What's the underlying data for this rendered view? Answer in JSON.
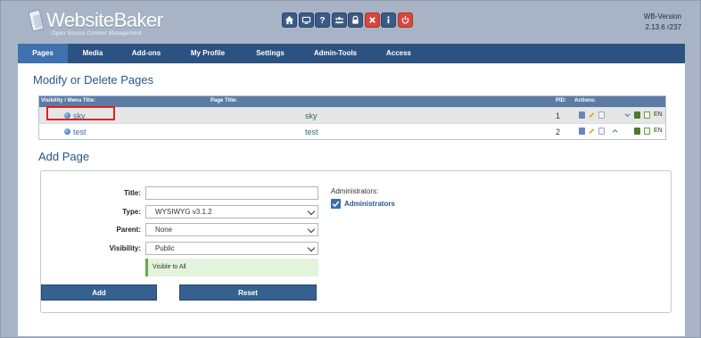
{
  "brand": {
    "name": "WebsiteBaker",
    "tagline": "Open Source Content Management"
  },
  "version": {
    "line1": "WB-Version",
    "line2": "2.13.6 r237"
  },
  "toolbar_icons": [
    "home-icon",
    "monitor-icon",
    "help-icon",
    "users-icon",
    "lock-icon",
    "close-icon",
    "info-icon",
    "power-icon"
  ],
  "nav": [
    {
      "label": "Pages",
      "active": true
    },
    {
      "label": "Media"
    },
    {
      "label": "Add-ons"
    },
    {
      "label": "My Profile"
    },
    {
      "label": "Settings"
    },
    {
      "label": "Admin-Tools"
    },
    {
      "label": "Access"
    }
  ],
  "modify": {
    "heading": "Modify or Delete Pages",
    "columns": {
      "visibility": "Visibility / Menu Title:",
      "page_title": "Page Title:",
      "pid": "PID:",
      "actions": "Actions:"
    },
    "rows": [
      {
        "menu_title": "sky",
        "page_title": "sky",
        "pid": "1",
        "lang": "EN"
      },
      {
        "menu_title": "test",
        "page_title": "test",
        "pid": "2",
        "lang": "EN"
      }
    ]
  },
  "add_page": {
    "heading": "Add Page",
    "title_label": "Title:",
    "title_value": "",
    "type_label": "Type:",
    "type_value": "WYSIWYG v3.1.2",
    "parent_label": "Parent:",
    "parent_value": "None",
    "visibility_label": "Visibility:",
    "visibility_value": "Public",
    "visibility_note": "Visible to All",
    "admins_label": "Administrators:",
    "admins_group": "Administrators",
    "add_button": "Add",
    "reset_button": "Reset"
  },
  "colors": {
    "nav": "#2c5281",
    "nav_active": "#3f72ad",
    "accent": "#2c5487",
    "danger": "#d9463b",
    "background": "#a8b4c5"
  }
}
